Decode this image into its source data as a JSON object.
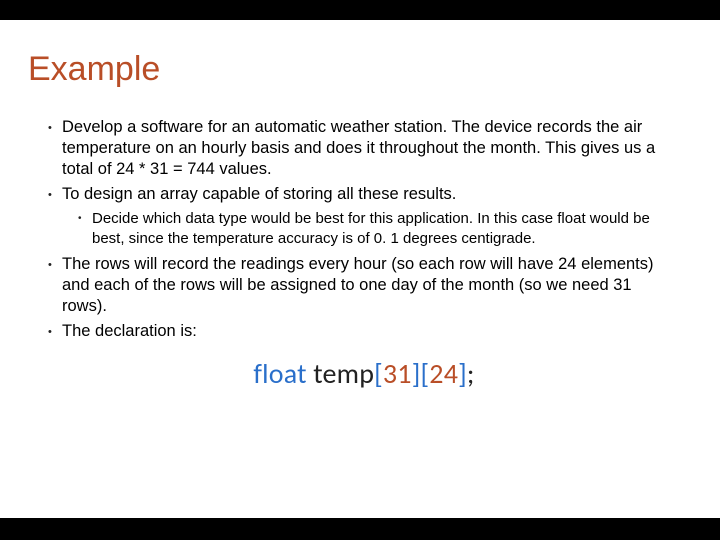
{
  "title": "Example",
  "bullets": {
    "b1": "Develop a software for an automatic weather station. The device records the air temperature on an hourly basis and does it throughout the month. This gives us a total of 24 * 31 = 744 values.",
    "b2": "To design an array capable of storing all these results.",
    "b2_1": "Decide which data type would be best for this application.  In this case float would be best, since the temperature accuracy is of 0. 1 degrees centigrade.",
    "b3": "The rows will record the readings every hour (so each row will have 24 elements) and each of the rows will be assigned to one day of the month (so we need 31 rows).",
    "b4": "The declaration is:"
  },
  "code": {
    "keyword": "float",
    "space": " ",
    "identifier": "temp",
    "lbr1": "[",
    "dim1": "31",
    "rbr1": "]",
    "lbr2": "[",
    "dim2": "24",
    "rbr2": "]",
    "semi": ";"
  }
}
